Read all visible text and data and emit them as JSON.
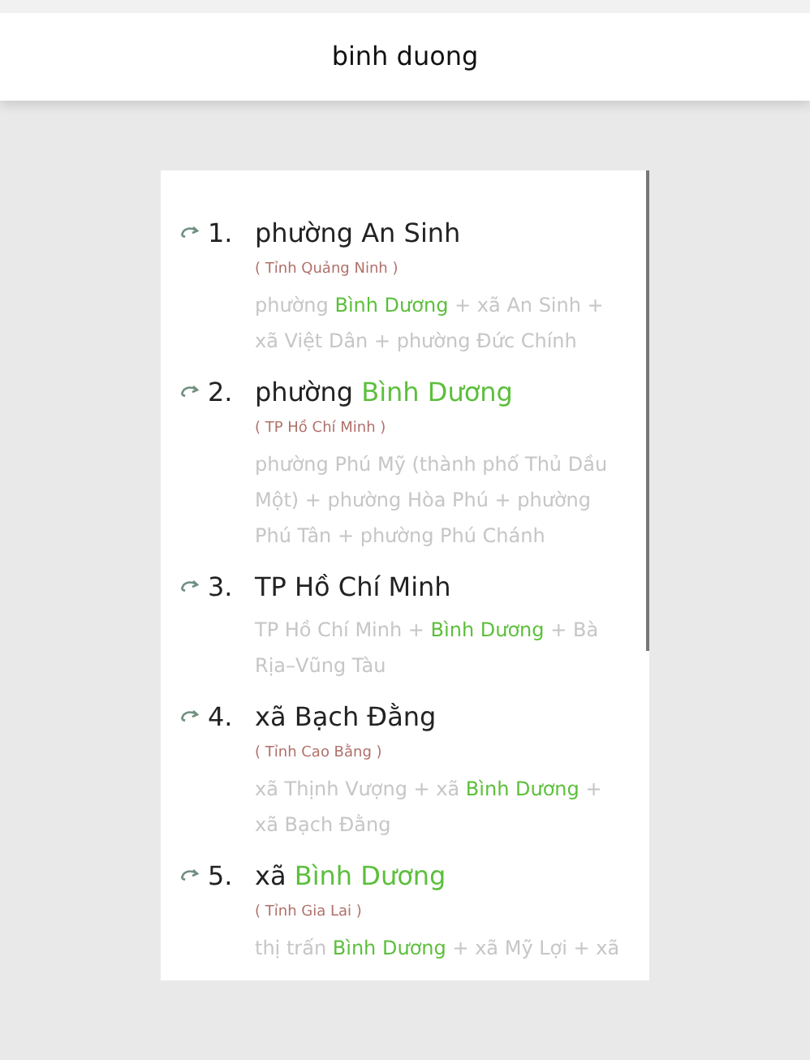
{
  "header": {
    "title": "binh duong"
  },
  "results": [
    {
      "number": "1.",
      "title": [
        {
          "text": "phường An Sinh",
          "highlight": false
        }
      ],
      "region": "( Tỉnh Quảng Ninh )",
      "description": [
        {
          "text": "phường ",
          "highlight": false
        },
        {
          "text": "Bình Dương",
          "highlight": true
        },
        {
          "text": " + xã An Sinh + xã Việt Dân + phường Đức Chính",
          "highlight": false
        }
      ]
    },
    {
      "number": "2.",
      "title": [
        {
          "text": "phường ",
          "highlight": false
        },
        {
          "text": "Bình Dương",
          "highlight": true
        }
      ],
      "region": "( TP Hồ Chí Minh )",
      "description": [
        {
          "text": "phường Phú Mỹ (thành phố Thủ Dầu Một) + phường Hòa Phú + phường Phú Tân + phường Phú Chánh",
          "highlight": false
        }
      ]
    },
    {
      "number": "3.",
      "title": [
        {
          "text": "TP Hồ Chí Minh",
          "highlight": false
        }
      ],
      "description": [
        {
          "text": "TP Hồ Chí Minh + ",
          "highlight": false
        },
        {
          "text": "Bình Dương",
          "highlight": true
        },
        {
          "text": " + Bà Rịa–Vũng Tàu",
          "highlight": false
        }
      ]
    },
    {
      "number": "4.",
      "title": [
        {
          "text": "xã Bạch Đằng",
          "highlight": false
        }
      ],
      "region": "( Tỉnh Cao Bằng )",
      "description": [
        {
          "text": "xã Thịnh Vượng + xã ",
          "highlight": false
        },
        {
          "text": "Bình Dương",
          "highlight": true
        },
        {
          "text": " + xã Bạch Đằng",
          "highlight": false
        }
      ]
    },
    {
      "number": "5.",
      "title": [
        {
          "text": "xã ",
          "highlight": false
        },
        {
          "text": "Bình Dương",
          "highlight": true
        }
      ],
      "region": "( Tỉnh Gia Lai )",
      "description": [
        {
          "text": "thị trấn ",
          "highlight": false
        },
        {
          "text": "Bình Dương",
          "highlight": true
        },
        {
          "text": " + xã Mỹ Lợi + xã",
          "highlight": false
        }
      ]
    }
  ]
}
